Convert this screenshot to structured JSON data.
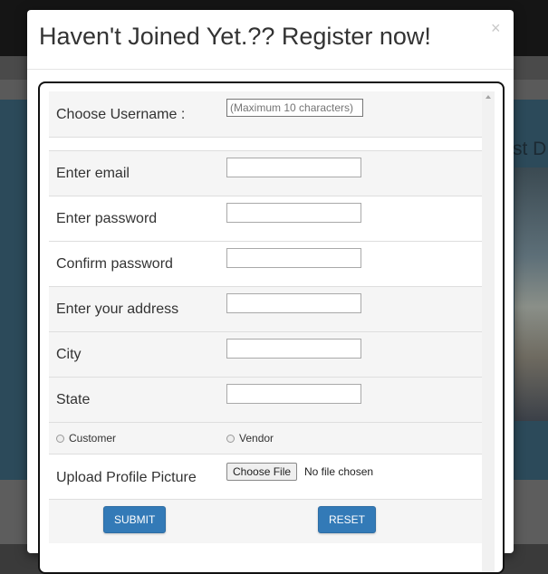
{
  "background": {
    "hero_text": "st D"
  },
  "modal": {
    "title": "Haven't Joined Yet.?? Register now!",
    "close_label": "×"
  },
  "form": {
    "username": {
      "label": "Choose Username :",
      "placeholder": "(Maximum 10 characters)"
    },
    "email": {
      "label": "Enter email",
      "value": ""
    },
    "password": {
      "label": "Enter password",
      "value": ""
    },
    "confirm_password": {
      "label": "Confirm password",
      "value": ""
    },
    "address": {
      "label": "Enter your address",
      "value": ""
    },
    "city": {
      "label": "City",
      "value": ""
    },
    "state": {
      "label": "State",
      "value": ""
    },
    "role_options": [
      {
        "label": "Customer",
        "checked": false
      },
      {
        "label": "Vendor",
        "checked": false
      }
    ],
    "upload": {
      "label": "Upload Profile Picture",
      "button": "Choose File",
      "status": "No file chosen"
    },
    "submit_label": "SUBMIT",
    "reset_label": "RESET"
  },
  "colors": {
    "primary_button": "#337ab7",
    "row_shade": "#f5f5f5"
  }
}
